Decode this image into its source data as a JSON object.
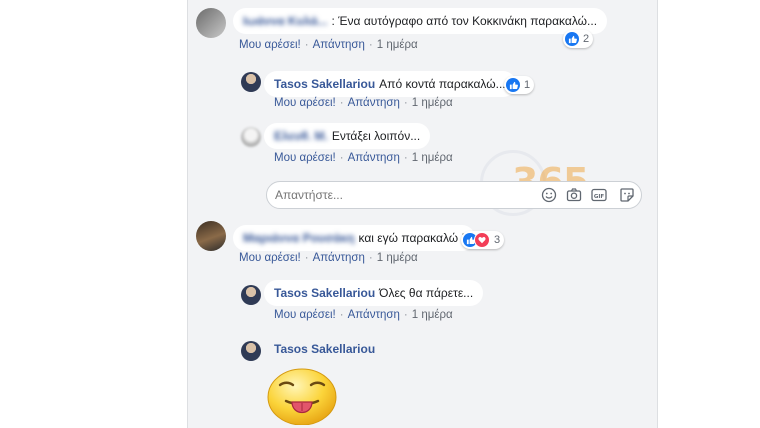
{
  "comments": [
    {
      "author": "Ιωάννα Κυλά...",
      "text": ": Ένα αυτόγραφο από τον Κοκκινάκη παρακαλώ...",
      "reaction_count": "2",
      "like": "Μου αρέσει!",
      "reply": "Απάντηση",
      "time": "1 ημέρα"
    },
    {
      "author": "Tasos Sakellariou",
      "text": "Από κοντά παρακαλώ...",
      "reaction_count": "1",
      "like": "Μου αρέσει!",
      "reply": "Απάντηση",
      "time": "1 ημέρα"
    },
    {
      "author": "Ελευθ. Μ.",
      "text": "Εντάξει λοιπόν...",
      "like": "Μου αρέσει!",
      "reply": "Απάντηση",
      "time": "1 ημέρα"
    },
    {
      "author": "Μαριάννα Ρουσάκη",
      "text": "και εγώ παρακαλώ !",
      "reaction_count": "3",
      "like": "Μου αρέσει!",
      "reply": "Απάντηση",
      "time": "1 ημέρα"
    },
    {
      "author": "Tasos Sakellariou",
      "text": "Όλες θα πάρετε...",
      "like": "Μου αρέσει!",
      "reply": "Απάντηση",
      "time": "1 ημέρα"
    },
    {
      "author": "Tasos Sakellariou"
    }
  ],
  "reply_box": {
    "placeholder": "Απαντήστε..."
  },
  "watermark": "365",
  "icons": [
    "like-icon",
    "love-icon",
    "emoji-icon",
    "camera-icon",
    "gif-icon",
    "sticker-icon",
    "tongue-emoji-sticker"
  ],
  "colors": {
    "link": "#385898",
    "like_blue": "#1877f2",
    "love_red": "#f33e58",
    "panel_bg": "#f2f3f5"
  }
}
